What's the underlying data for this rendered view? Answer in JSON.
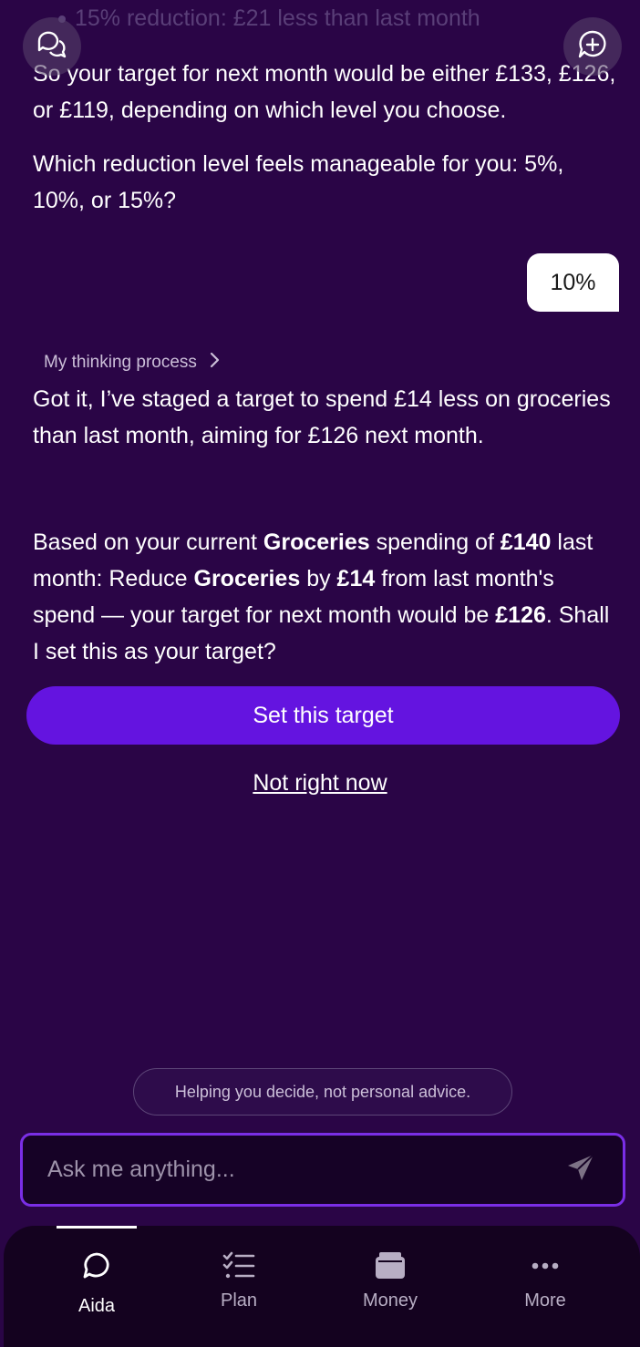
{
  "header": {
    "left_icon": "chat-bubbles-icon",
    "right_icon": "new-chat-icon"
  },
  "messages": {
    "faded_bullet": "15% reduction: £21 less than last month",
    "assistant_1": {
      "p1": "So your target for next month would be either £133, £126, or £119, depending on which level you choose.",
      "p2": "Which reduction level feels manageable for you: 5%, 10%, or 15%?"
    },
    "user_reply": "10%",
    "thinking_label": "My thinking process",
    "assistant_2": {
      "p1": "Got it, I’ve staged a target to spend £14 less on groceries than last month, aiming for £126 next month.",
      "p2_a": "Based on your current ",
      "p2_b": "Groceries",
      "p2_c": " spending of ",
      "p2_d": "£140",
      "p2_e": " last month: Reduce ",
      "p2_f": "Groceries",
      "p2_g": " by ",
      "p2_h": "£14",
      "p2_i": " from last month's spend — your target for next month would be ",
      "p2_j": "£126",
      "p2_k": ". Shall I set this as your target?"
    }
  },
  "actions": {
    "primary": "Set this target",
    "secondary": "Not right now"
  },
  "disclaimer": "Helping you decide, not personal advice.",
  "composer": {
    "placeholder": "Ask me anything..."
  },
  "nav": {
    "items": [
      {
        "label": "Aida",
        "icon": "chat-icon",
        "active": true
      },
      {
        "label": "Plan",
        "icon": "checklist-icon",
        "active": false
      },
      {
        "label": "Money",
        "icon": "wallet-icon",
        "active": false
      },
      {
        "label": "More",
        "icon": "more-dots-icon",
        "active": false
      }
    ]
  },
  "colors": {
    "background": "#2a0546",
    "primary_button": "#6414e0",
    "input_border": "#7a2ee6",
    "nav_background": "#14021f"
  }
}
